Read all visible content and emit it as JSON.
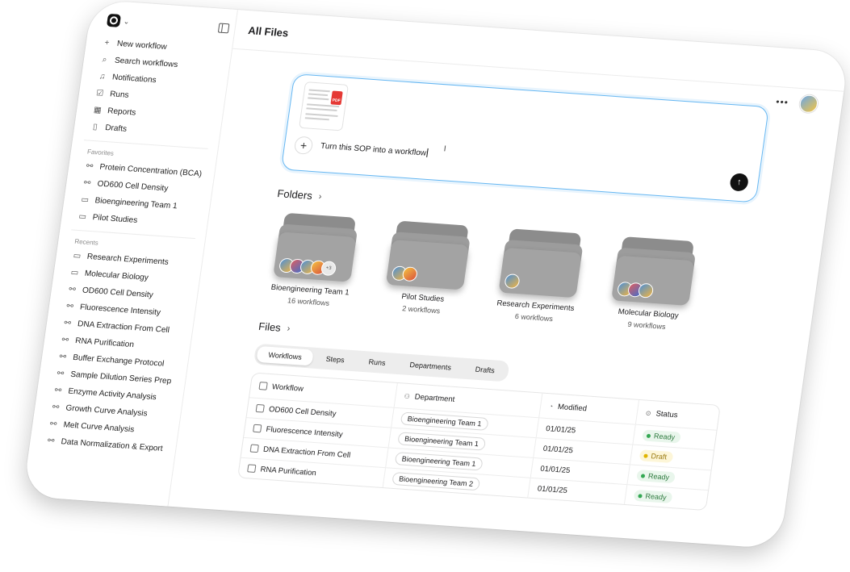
{
  "page": {
    "title": "All Files"
  },
  "sidebar": {
    "nav": [
      {
        "label": "New workflow",
        "icon": "plus-icon"
      },
      {
        "label": "Search workflows",
        "icon": "search-icon"
      },
      {
        "label": "Notifications",
        "icon": "bell-icon"
      },
      {
        "label": "Runs",
        "icon": "checkbox-icon"
      },
      {
        "label": "Reports",
        "icon": "grid-icon"
      },
      {
        "label": "Drafts",
        "icon": "document-icon"
      }
    ],
    "favorites_label": "Favorites",
    "favorites": [
      {
        "label": "Protein Concentration (BCA)",
        "icon": "workflow-icon"
      },
      {
        "label": "OD600 Cell Density",
        "icon": "workflow-icon"
      },
      {
        "label": "Bioengineering Team 1",
        "icon": "folder-icon"
      },
      {
        "label": "Pilot Studies",
        "icon": "folder-icon"
      }
    ],
    "recents_label": "Recents",
    "recents": [
      {
        "label": "Research Experiments",
        "icon": "folder-icon"
      },
      {
        "label": "Molecular Biology",
        "icon": "folder-icon"
      },
      {
        "label": "OD600 Cell Density",
        "icon": "workflow-icon"
      },
      {
        "label": "Fluorescence Intensity",
        "icon": "workflow-icon"
      },
      {
        "label": "DNA Extraction From Cell",
        "icon": "workflow-icon"
      },
      {
        "label": "RNA Purification",
        "icon": "workflow-icon"
      },
      {
        "label": "Buffer Exchange Protocol",
        "icon": "workflow-icon"
      },
      {
        "label": "Sample Dilution Series Prep",
        "icon": "workflow-icon"
      },
      {
        "label": "Enzyme Activity Analysis",
        "icon": "workflow-icon"
      },
      {
        "label": "Growth Curve Analysis",
        "icon": "workflow-icon"
      },
      {
        "label": "Melt Curve Analysis",
        "icon": "workflow-icon"
      },
      {
        "label": "Data Normalization & Export",
        "icon": "workflow-icon"
      }
    ]
  },
  "prompt": {
    "text": "Turn this SOP into a workflow",
    "attachment_badge": "PDF"
  },
  "folders_section": {
    "title": "Folders"
  },
  "folders": [
    {
      "name": "Bioengineering Team 1",
      "count": "16 workflows",
      "extra_members": "+3"
    },
    {
      "name": "Pilot Studies",
      "count": "2 workflows"
    },
    {
      "name": "Research Experiments",
      "count": "6 workflows"
    },
    {
      "name": "Molecular Biology",
      "count": "9 workflows"
    }
  ],
  "files_section": {
    "title": "Files"
  },
  "tabs": [
    "Workflows",
    "Steps",
    "Runs",
    "Departments",
    "Drafts"
  ],
  "table": {
    "headers": {
      "workflow": "Workflow",
      "department": "Department",
      "modified": "Modified",
      "status": "Status"
    },
    "rows": [
      {
        "workflow": "OD600 Cell Density",
        "department": "Bioengineering Team 1",
        "modified": "01/01/25",
        "status": "Ready"
      },
      {
        "workflow": "Fluorescence Intensity",
        "department": "Bioengineering Team 1",
        "modified": "01/01/25",
        "status": "Draft"
      },
      {
        "workflow": "DNA Extraction From Cell",
        "department": "Bioengineering Team 1",
        "modified": "01/01/25",
        "status": "Ready"
      },
      {
        "workflow": "RNA Purification",
        "department": "Bioengineering Team 2",
        "modified": "01/01/25",
        "status": "Ready"
      }
    ]
  },
  "colors": {
    "accent": "#66b7f2",
    "ready": "#34a853",
    "draft": "#e0b400"
  }
}
